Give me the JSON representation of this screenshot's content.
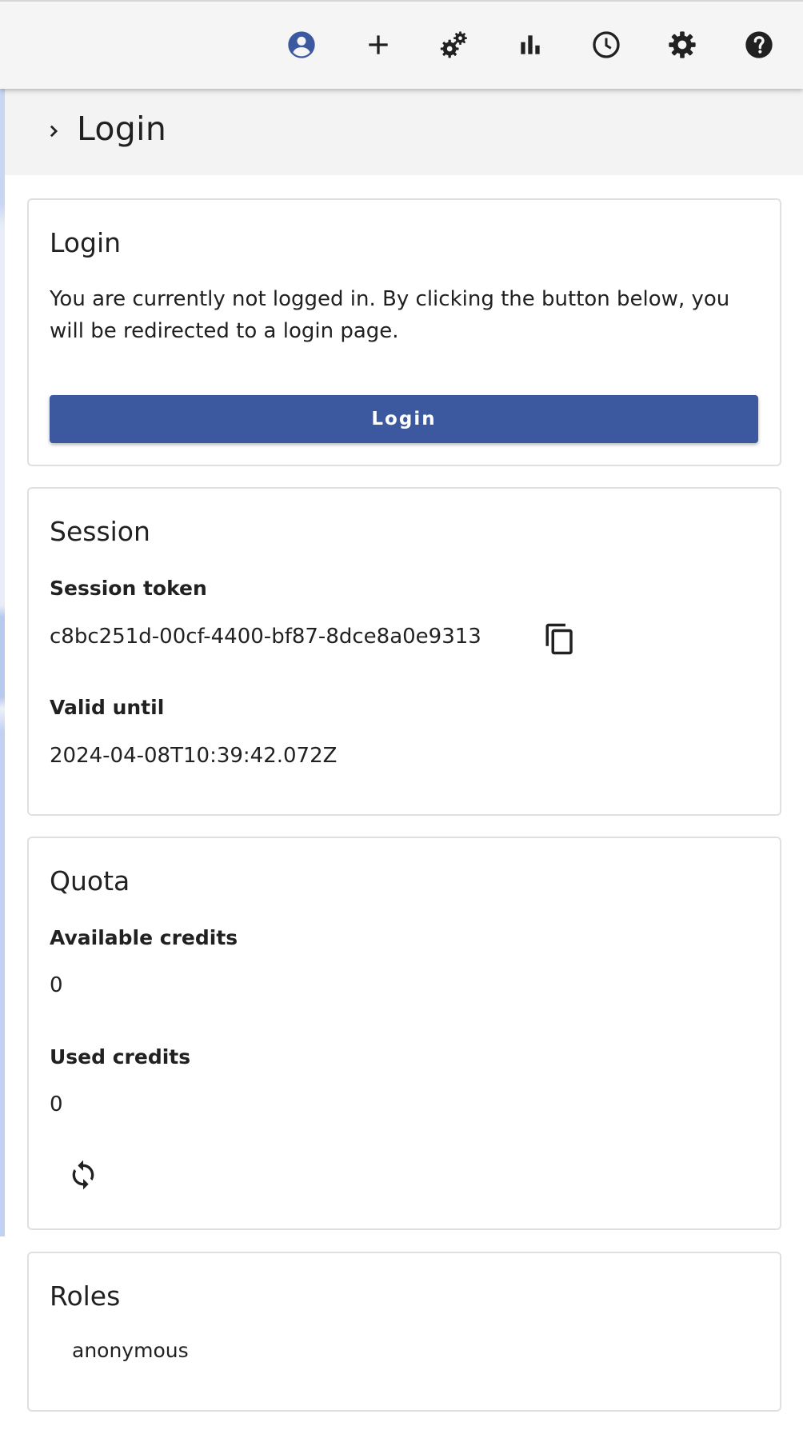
{
  "toolbar": {
    "icons": [
      "account-circle-icon",
      "add-icon",
      "cogs-icon",
      "bar-chart-icon",
      "clock-icon",
      "settings-icon",
      "help-icon"
    ],
    "accent_color": "#3c589e"
  },
  "header": {
    "title": "Login"
  },
  "login_card": {
    "title": "Login",
    "message": "You are currently not logged in. By clicking the button below, you will be redirected to a login page.",
    "button_label": "Login"
  },
  "session_card": {
    "title": "Session",
    "token_label": "Session token",
    "token_value": "c8bc251d-00cf-4400-bf87-8dce8a0e9313",
    "valid_label": "Valid until",
    "valid_value": "2024-04-08T10:39:42.072Z"
  },
  "quota_card": {
    "title": "Quota",
    "available_label": "Available credits",
    "available_value": "0",
    "used_label": "Used credits",
    "used_value": "0"
  },
  "roles_card": {
    "title": "Roles",
    "roles": [
      "anonymous"
    ]
  }
}
